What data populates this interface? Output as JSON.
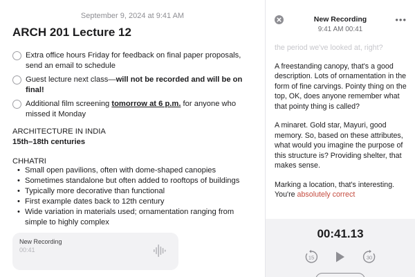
{
  "note": {
    "date": "September 9, 2024 at 9:41 AM",
    "title": "ARCH 201 Lecture 12",
    "checklist": [
      {
        "text": "Extra office hours Friday for feedback on final paper proposals, send an email to schedule"
      },
      {
        "text_a": "Guest lecture next class—",
        "text_b": "will not be recorded and will be on final!"
      },
      {
        "text_a": "Additional film screening ",
        "text_b": "tomorrow at 6 p.m.",
        "text_c": " for anyone who missed it Monday"
      }
    ],
    "section_heading": "ARCHITECTURE IN INDIA",
    "section_sub": "15th–18th centuries",
    "subsection": "CHHATRI",
    "bullets": [
      "Small open pavilions, often with dome-shaped canopies",
      "Sometimes standalone but often added to rooftops of buildings",
      "Typically more decorative than functional",
      "First example dates back to 12th century",
      "Wide variation in materials used; ornamentation ranging from simple to highly complex"
    ],
    "recording_card": {
      "title": "New Recording",
      "time": "00:41"
    }
  },
  "panel": {
    "title": "New Recording",
    "subtitle": "9:41 AM  00:41",
    "transcript": {
      "faded": "the period we've looked at, right?",
      "p1": "A freestanding canopy, that's a good description. Lots of ornamentation in the form of fine carvings. Pointy thing on the top, OK, does anyone remember what that pointy thing is called?",
      "p2": "A minaret. Gold star, Mayuri, good memory. So, based on these attributes, what would you imagine the purpose of this structure is? Providing shelter, that makes sense.",
      "p3_a": "Marking a location, that's interesting. You're ",
      "p3_b": "absolutely correct"
    },
    "player": {
      "timer": "00:41.13",
      "skip_back": "15",
      "skip_forward": "30"
    }
  },
  "colors": {
    "accent_red": "#c44b3f",
    "icon_gray": "#8e8e93",
    "panel_bg": "#f2f2f4"
  },
  "icons": [
    "close-icon",
    "more-icon",
    "waveform-icon",
    "skip-back-15-icon",
    "play-icon",
    "skip-forward-30-icon"
  ]
}
